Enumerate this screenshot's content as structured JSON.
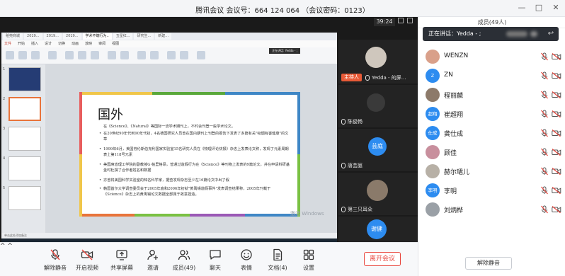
{
  "window": {
    "title": "腾讯会议  会议号：664 124 064  （会议密码：0123）"
  },
  "stage": {
    "timer": "39:24",
    "slide": {
      "title": "国外",
      "paragraphs": [
        "在《Science》、《Natural》等国际一流学术期刊上，不时会刊登一些学术论文。",
        "在20世纪90年代到90年代初，4名德国研究人员曾在国内期刊上刊登的报告下发表了多篇有关\"吸烟有害健康\"的文章",
        "1999年6月，美国劳伦斯伯克利国家实验室15名研究人员在《物理评论快报》杂志上发表论文称，发现了元素周期表上第118号元素",
        "美国麻省理工学院的副教授G·帕里格昂，曾通过造假行为在《Science》等刊物上发表的9篇论文，并在申请科研基金时杜撰了合作者姓名和数据",
        "亦曾将美国科学实验室的知名科学家，据查发现杂志至少在16篇论文中出了假",
        "韩国首尔大学调查委员会于2005年底和2006年初就\"黄禹锡造假事件\"发表调查结果称，2005年刊载于《Science》杂志上的黄禹锡论文数据全部属于故意捏造。"
      ],
      "thumb_numbers": [
        "1",
        "2",
        "3",
        "4",
        "5"
      ],
      "browser_tabs": [
        "稻壳商城",
        "2019...",
        "2019...",
        "2019...",
        "学术不端行为..",
        "五星红...",
        "研究生...",
        "新建..."
      ],
      "ribbon_items": [
        "开始",
        "插入",
        "设计",
        "切换",
        "动画",
        "放映",
        "审阅",
        "视图"
      ],
      "ribbon_accent": "文件",
      "tooltip": "正在讲话: Yedda - ;",
      "statusbar": "单击此处添加备注"
    },
    "watermark": {
      "line1": "激活 Windows",
      "line2": "转到\"设置\"以激活 Windows。"
    },
    "tiles": [
      {
        "label": "Yedda - 的屏...",
        "host_badge": "主持人",
        "type": "photo"
      },
      {
        "label": "陈俊畅",
        "avatar_text": "",
        "type": "blank"
      },
      {
        "label": "唐芸庭",
        "avatar_text": "芸庭",
        "type": "avatar"
      },
      {
        "label": "第三只耳朵",
        "avatar_text": "",
        "type": "photo"
      },
      {
        "label": "",
        "avatar_text": "谢健",
        "type": "avatar"
      }
    ]
  },
  "toolbar": {
    "items": [
      {
        "label": "解除静音",
        "icon": "mic-off-icon"
      },
      {
        "label": "开启视频",
        "icon": "camera-off-icon"
      },
      {
        "label": "共享屏幕",
        "icon": "share-screen-icon"
      },
      {
        "label": "邀请",
        "icon": "invite-icon"
      },
      {
        "label": "成员(49)",
        "icon": "members-icon"
      },
      {
        "label": "聊天",
        "icon": "chat-icon"
      },
      {
        "label": "表情",
        "icon": "emoji-icon"
      },
      {
        "label": "文档(4)",
        "icon": "document-icon"
      },
      {
        "label": "设置",
        "icon": "settings-icon"
      }
    ],
    "leave": "离开会议"
  },
  "panel": {
    "title": "成员(49人)",
    "speaking": "正在讲话：Yedda - ;",
    "members": [
      {
        "name": "WENZN",
        "avatar": "",
        "color": "#d9a08a"
      },
      {
        "name": "ZN",
        "avatar": "Z",
        "color": "#2d8cf0"
      },
      {
        "name": "程丽麟",
        "avatar": "",
        "color": "#8d7a6a"
      },
      {
        "name": "崔超翔",
        "avatar": "超翔",
        "color": "#2d8cf0"
      },
      {
        "name": "龚仕成",
        "avatar": "仕成",
        "color": "#2d8cf0"
      },
      {
        "name": "顾佳",
        "avatar": "",
        "color": "#c88f9d"
      },
      {
        "name": "赫尔珺儿",
        "avatar": "",
        "color": "#b7b0a6"
      },
      {
        "name": "李明",
        "avatar": "李明",
        "color": "#2d8cf0"
      },
      {
        "name": "刘炳桦",
        "avatar": "",
        "color": "#9aa0a6"
      }
    ],
    "unmute_all": "解除静音"
  },
  "colors": {
    "accent_blue": "#2d8cf0",
    "host_orange": "#e75a37",
    "leave_red": "#e8453c",
    "muted_red": "#e8453c"
  }
}
